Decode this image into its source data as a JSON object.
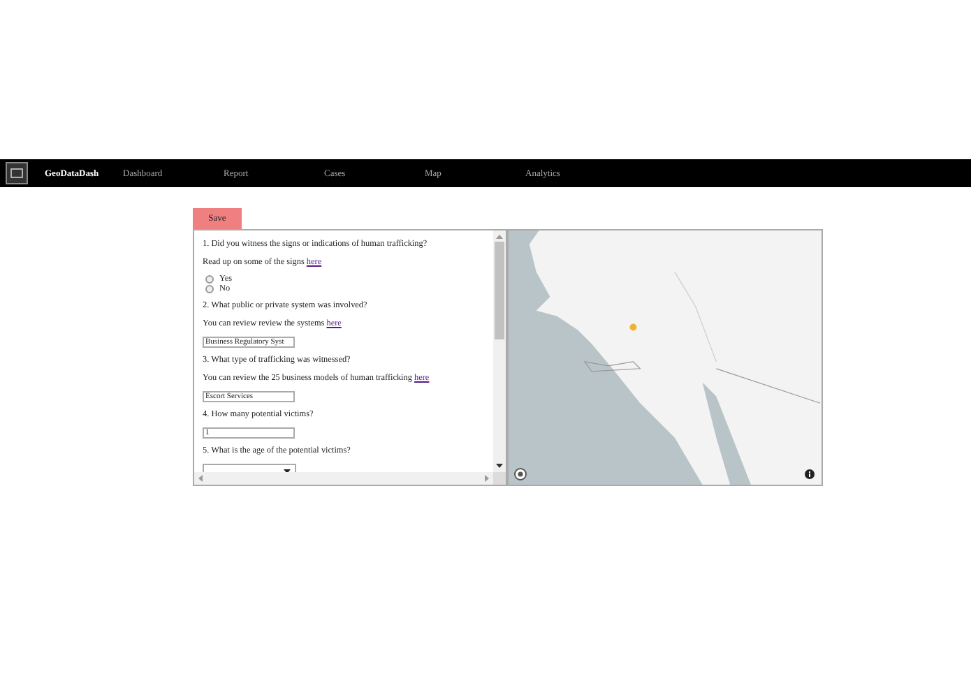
{
  "nav": {
    "brand": "GeoDataDash",
    "items": [
      {
        "label": "Dashboard"
      },
      {
        "label": "Report"
      },
      {
        "label": "Cases"
      },
      {
        "label": "Map"
      },
      {
        "label": "Analytics"
      }
    ]
  },
  "save_button": "Save",
  "questions": [
    {
      "kind": "radio",
      "question": "1. Did you witness the signs or indications of human trafficking?",
      "note": "Read up on some of the signs",
      "link": "here",
      "options": [
        {
          "label": "Yes",
          "selected": false
        },
        {
          "label": "No",
          "selected": false
        }
      ]
    },
    {
      "kind": "text",
      "question": "2. What public or private system was involved?",
      "note": "You can review review the systems",
      "link": "here",
      "value": "Business Regulatory Syst"
    },
    {
      "kind": "text",
      "question": "3. What type of trafficking was witnessed?",
      "note": "You can review the 25 business models of human trafficking",
      "link": "here",
      "value": "Escort Services"
    },
    {
      "kind": "text",
      "question": "4. How many potential victims?",
      "value": "1"
    },
    {
      "kind": "select",
      "question": "5. What is the age of the potential victims?"
    }
  ]
}
